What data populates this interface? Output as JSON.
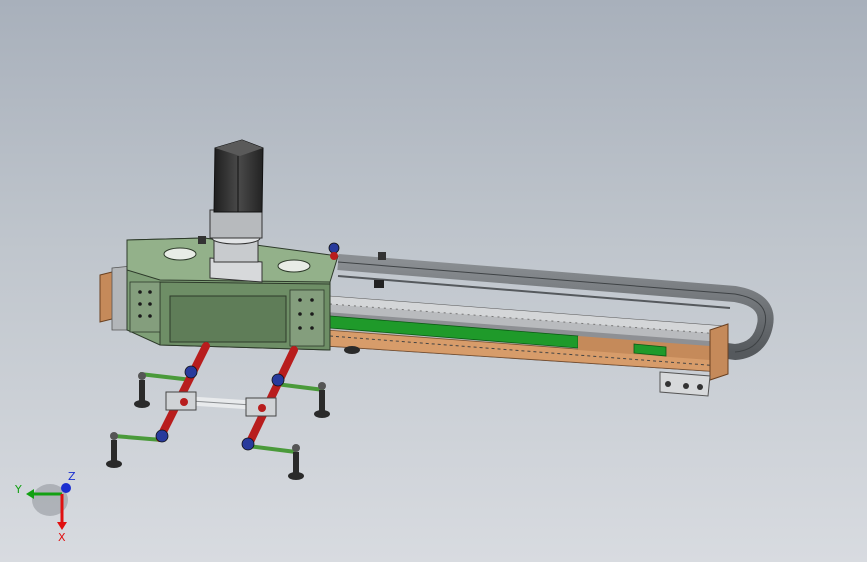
{
  "axes": {
    "y_label": "Y",
    "z_label": "Z",
    "x_label": "X",
    "colors": {
      "x": "#e01010",
      "y": "#12a012",
      "z": "#1a2fd0"
    }
  },
  "colors": {
    "carriage": "#7f9f77",
    "carriage_dark": "#5f7d58",
    "motor": "#3a3a3a",
    "rail": "#a6a8ab",
    "copper": "#c58a5a",
    "strip": "#1f9a2a",
    "chain": "#6c7074",
    "arm": "#b81d1d",
    "joint": "#283a9c",
    "rod": "#4a9a3a",
    "foot": "#2a2a2a"
  }
}
